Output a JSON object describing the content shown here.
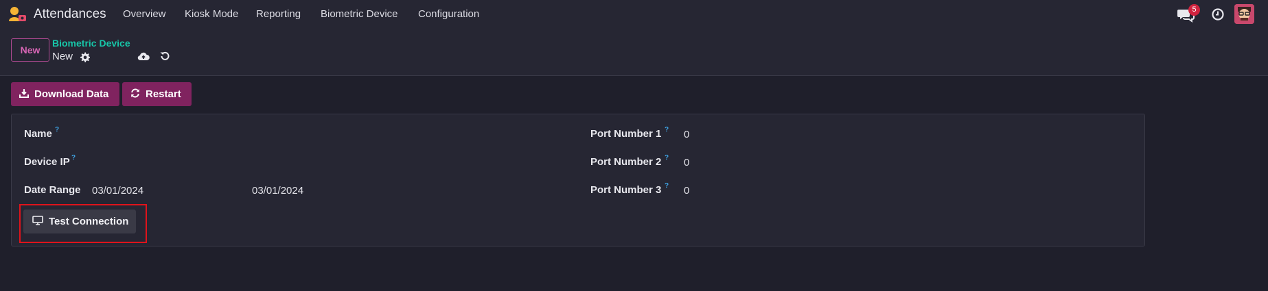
{
  "navbar": {
    "app_name": "Attendances",
    "menu": [
      {
        "label": "Overview"
      },
      {
        "label": "Kiosk Mode"
      },
      {
        "label": "Reporting"
      },
      {
        "label": "Biometric Device"
      },
      {
        "label": "Configuration"
      }
    ],
    "chat_badge": "5",
    "icons": {
      "app": "attendances-logo-icon",
      "chat": "chat-icon",
      "activity": "clock-icon",
      "user": "avatar"
    }
  },
  "control_panel": {
    "new_label": "New",
    "breadcrumb": "Biometric Device",
    "record_name": "New",
    "icons": {
      "settings": "gear-icon",
      "save": "cloud-upload-icon",
      "discard": "undo-icon"
    }
  },
  "actions": {
    "download_label": "Download Data",
    "restart_label": "Restart",
    "icons": {
      "download": "download-icon",
      "restart": "refresh-icon"
    }
  },
  "form": {
    "help_mark": "?",
    "name_label": "Name",
    "name_value": "",
    "device_ip_label": "Device IP",
    "device_ip_value": "",
    "date_range_label": "Date Range",
    "date_from": "03/01/2024",
    "date_to": "03/01/2024",
    "port1_label": "Port Number 1",
    "port1_value": "0",
    "port2_label": "Port Number 2",
    "port2_value": "0",
    "port3_label": "Port Number 3",
    "port3_value": "0",
    "test_connection_label": "Test Connection",
    "icons": {
      "test_connection": "monitor-icon"
    }
  },
  "colors": {
    "background": "#1f1f2b",
    "panel": "#262633",
    "primary": "#80235f",
    "breadcrumb": "#17c6a8",
    "help": "#3fa4e6",
    "highlight": "#e0131b",
    "badge": "#d0233f"
  }
}
